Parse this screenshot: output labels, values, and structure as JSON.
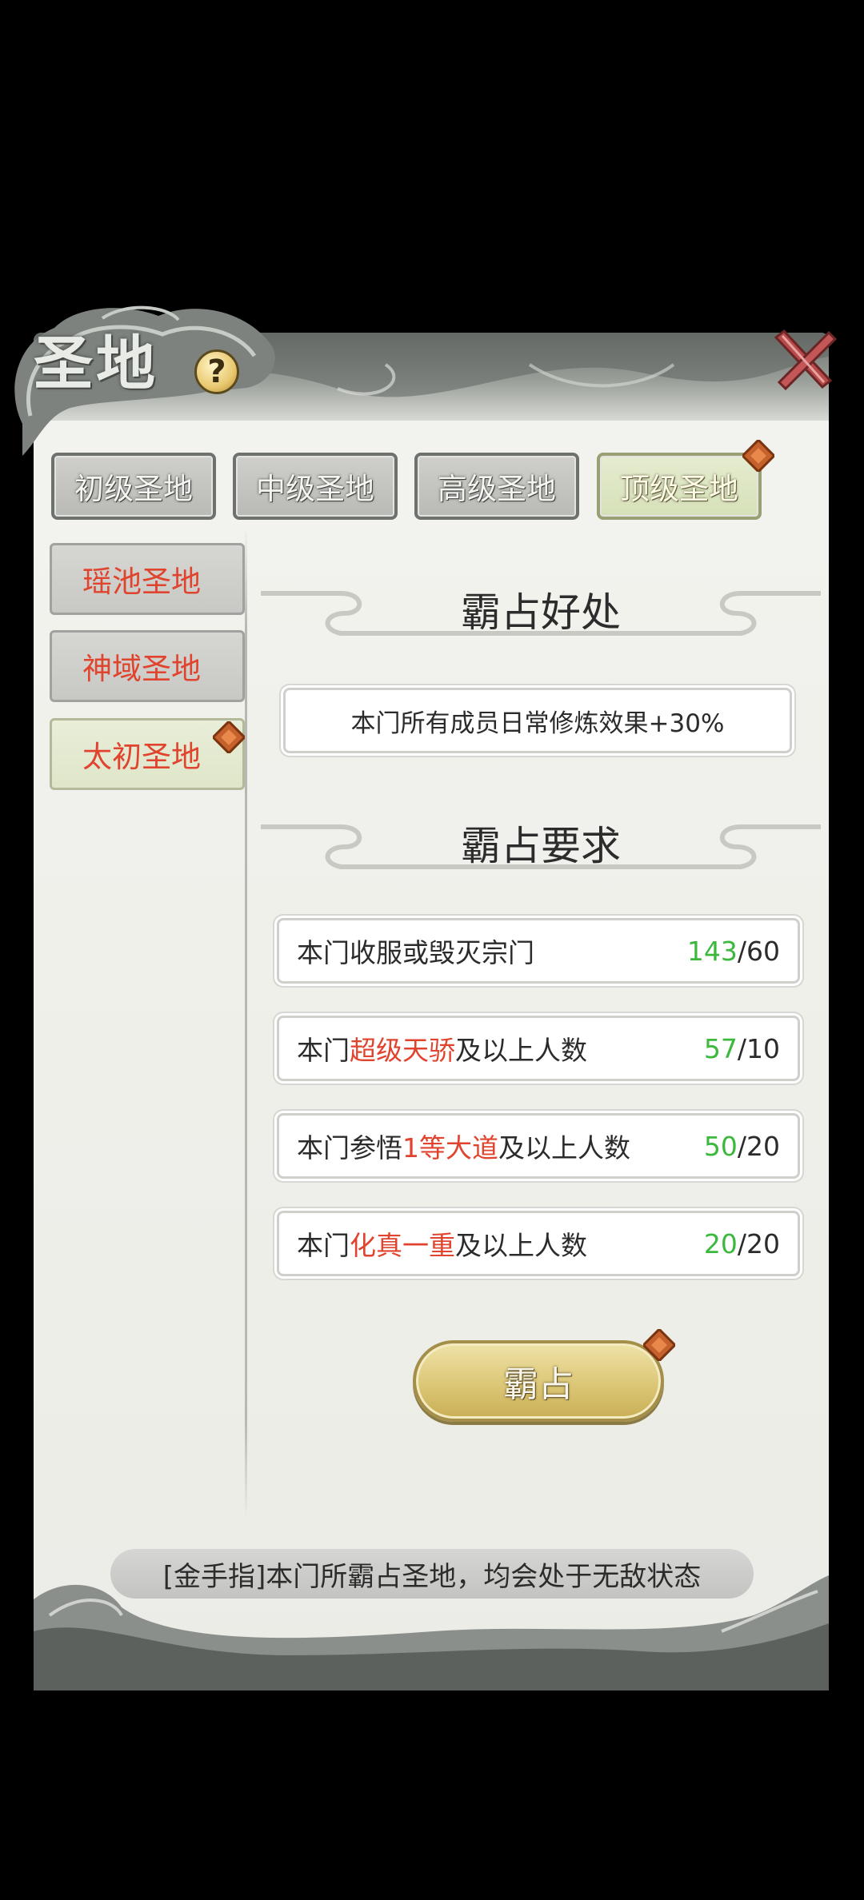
{
  "header": {
    "title": "圣地",
    "help_symbol": "?"
  },
  "tabs": [
    {
      "label": "初级圣地",
      "active": false
    },
    {
      "label": "中级圣地",
      "active": false
    },
    {
      "label": "高级圣地",
      "active": false
    },
    {
      "label": "顶级圣地",
      "active": true,
      "badge": true
    }
  ],
  "sidebar": {
    "items": [
      {
        "label": "瑶池圣地",
        "active": false
      },
      {
        "label": "神域圣地",
        "active": false
      },
      {
        "label": "太初圣地",
        "active": true,
        "badge": true
      }
    ]
  },
  "benefits": {
    "title": "霸占好处",
    "text": "本门所有成员日常修炼效果+30%"
  },
  "requirements": {
    "title": "霸占要求",
    "items": [
      {
        "prefix": "本门收服或毁灭宗门",
        "highlight": "",
        "suffix": "",
        "current": "143",
        "target": "/60"
      },
      {
        "prefix": "本门",
        "highlight": "超级天骄",
        "suffix": "及以上人数",
        "current": "57",
        "target": "/10"
      },
      {
        "prefix": "本门参悟",
        "highlight": "1等大道",
        "suffix": "及以上人数",
        "current": "50",
        "target": "/20"
      },
      {
        "prefix": "本门",
        "highlight": "化真一重",
        "suffix": "及以上人数",
        "current": "20",
        "target": "/20"
      }
    ]
  },
  "action": {
    "occupy_label": "霸占"
  },
  "tip": {
    "text": "[金手指]本门所霸占圣地，均会处于无敌状态"
  },
  "colors": {
    "highlight_red": "#e0442e",
    "progress_green": "#3cb83c",
    "gold_button": "#dcc777"
  }
}
